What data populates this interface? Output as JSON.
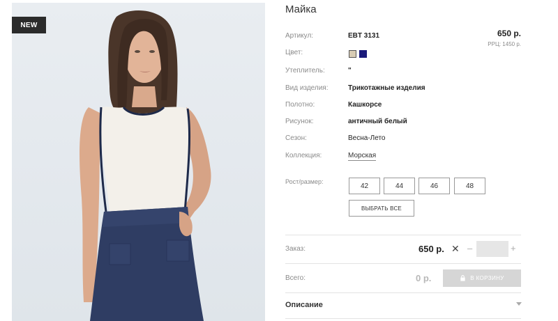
{
  "product": {
    "badge": "NEW",
    "title": "Майка",
    "price": "650 р.",
    "rrp": "РРЦ: 1450 р."
  },
  "attributes": [
    {
      "label": "Артикул:",
      "value": "EBT 3131"
    },
    {
      "label": "Цвет:",
      "value": ""
    },
    {
      "label": "Утеплитель:",
      "value": "\""
    },
    {
      "label": "Вид изделия:",
      "value": "Трикотажные изделия"
    },
    {
      "label": "Полотно:",
      "value": "Кашкорсе"
    },
    {
      "label": "Рисунок:",
      "value": "античный белый"
    },
    {
      "label": "Сезон:",
      "value": "Весна-Лето"
    },
    {
      "label": "Коллекция:",
      "value": "Морская"
    }
  ],
  "colors": [
    {
      "name": "beige",
      "hex": "#d8ccb4"
    },
    {
      "name": "navy",
      "hex": "#1a1a7a"
    }
  ],
  "sizes": {
    "label": "Рост/размер:",
    "options": [
      "42",
      "44",
      "46",
      "48"
    ],
    "select_all": "ВЫБРАТЬ ВСЕ"
  },
  "order": {
    "label": "Заказ:",
    "price": "650 р.",
    "times": "✕",
    "minus": "–",
    "plus": "+",
    "quantity": ""
  },
  "total": {
    "label": "Всего:",
    "price": "0 р.",
    "cart_button": "В КОРЗИНУ"
  },
  "description": {
    "label": "Описание"
  }
}
